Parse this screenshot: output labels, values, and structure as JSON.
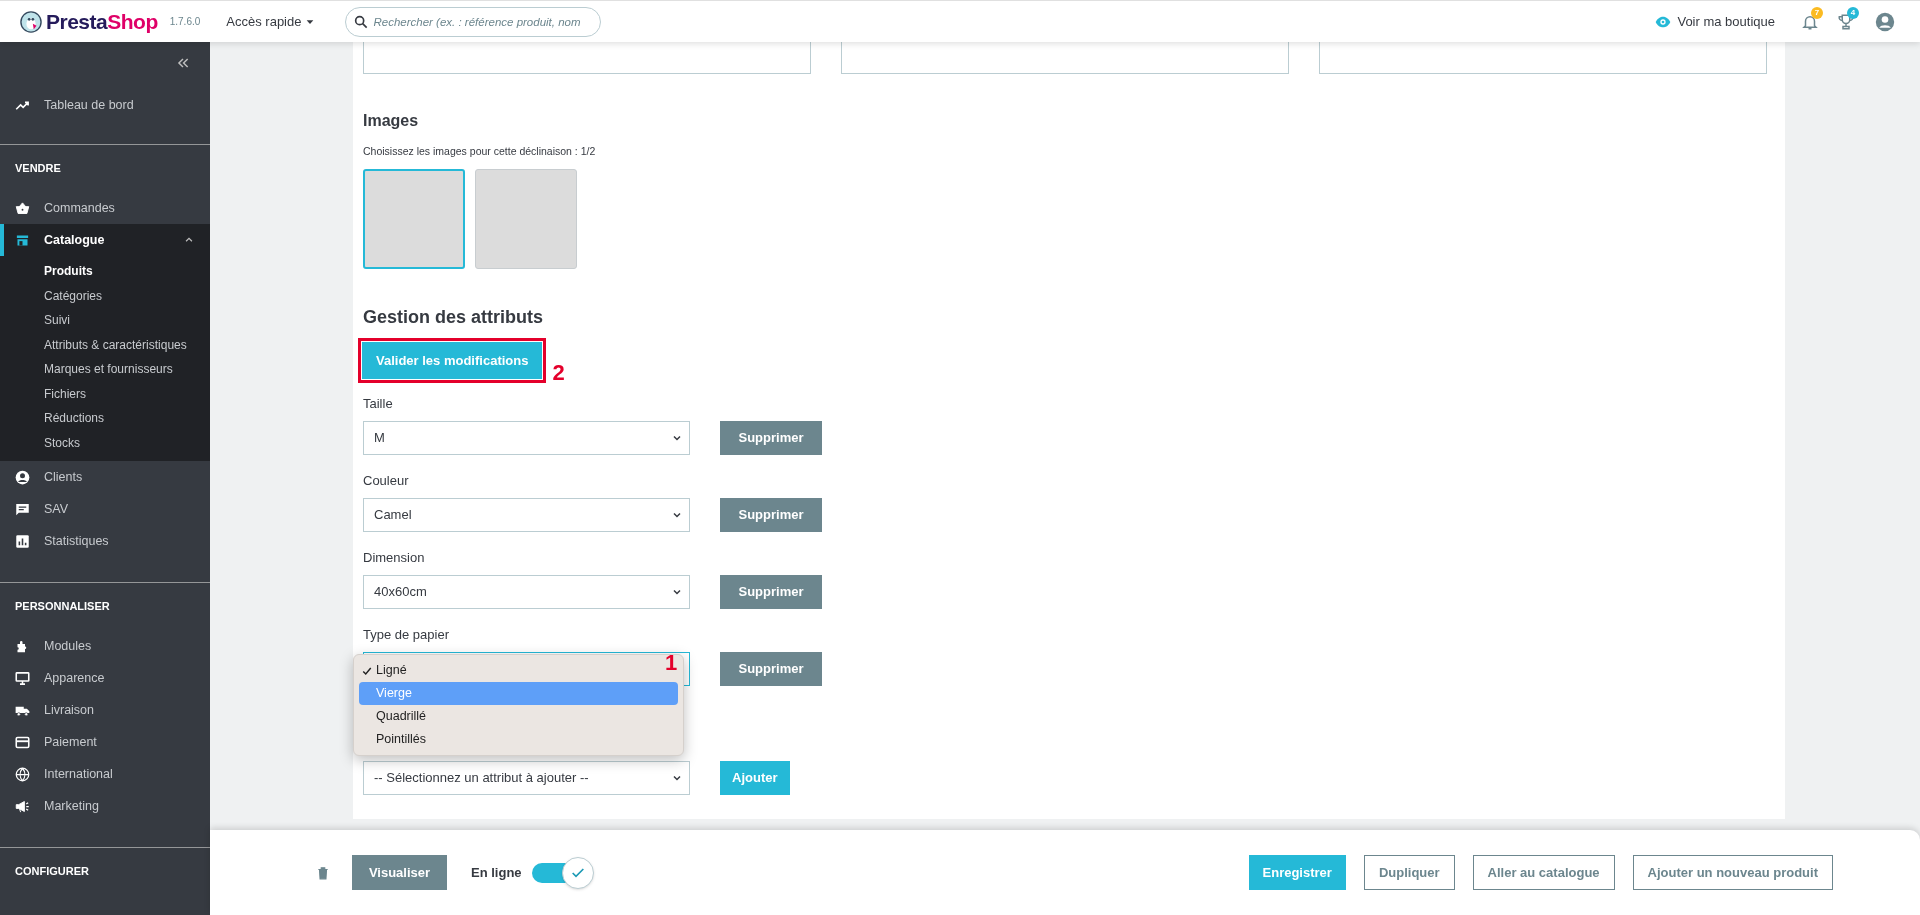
{
  "header": {
    "logo": [
      "Presta",
      "Shop"
    ],
    "version": "1.7.6.0",
    "quick_access": "Accès rapide",
    "search": {
      "placeholder": "Rechercher (ex. : référence produit, nom"
    },
    "view_shop": "Voir ma boutique",
    "notifications_badge": "7",
    "trophy_badge": "4"
  },
  "sidebar": {
    "sections": [
      {
        "items": [
          {
            "label": "Tableau de bord",
            "selected": false
          }
        ]
      },
      {
        "title": "VENDRE",
        "items": [
          {
            "label": "Commandes",
            "selected": false
          },
          {
            "label": "Catalogue",
            "selected": true,
            "children": [
              {
                "label": "Produits",
                "selected": true
              },
              {
                "label": "Catégories",
                "selected": false
              },
              {
                "label": "Suivi",
                "selected": false
              },
              {
                "label": "Attributs & caractéristiques",
                "selected": false
              },
              {
                "label": "Marques et fournisseurs",
                "selected": false
              },
              {
                "label": "Fichiers",
                "selected": false
              },
              {
                "label": "Réductions",
                "selected": false
              },
              {
                "label": "Stocks",
                "selected": false
              }
            ]
          },
          {
            "label": "Clients",
            "selected": false
          },
          {
            "label": "SAV",
            "selected": false
          },
          {
            "label": "Statistiques",
            "selected": false
          }
        ]
      },
      {
        "title": "PERSONNALISER",
        "items": [
          {
            "label": "Modules",
            "selected": false
          },
          {
            "label": "Apparence",
            "selected": false
          },
          {
            "label": "Livraison",
            "selected": false
          },
          {
            "label": "Paiement",
            "selected": false
          },
          {
            "label": "International",
            "selected": false
          },
          {
            "label": "Marketing",
            "selected": false
          }
        ]
      },
      {
        "title": "CONFIGURER"
      }
    ]
  },
  "images": {
    "title": "Images",
    "hint": "Choisissez les images pour cette déclinaison : 1/2",
    "thumbnails": [
      {
        "selected": true
      },
      {
        "selected": false
      }
    ]
  },
  "attributes": {
    "title": "Gestion des attributs",
    "save_button": {
      "label": "Valider les modifications",
      "annotation": "2"
    },
    "rows": [
      {
        "label": "Taille",
        "value": "M",
        "delete_button": "Supprimer"
      },
      {
        "label": "Couleur",
        "value": "Camel",
        "delete_button": "Supprimer"
      },
      {
        "label": "Dimension",
        "value": "40x60cm",
        "delete_button": "Supprimer"
      },
      {
        "label": "Type de papier",
        "delete_button": "Supprimer",
        "annotation": "1",
        "options": [
          {
            "label": "Ligné",
            "checked": true,
            "highlighted": false
          },
          {
            "label": "Vierge",
            "checked": false,
            "highlighted": true
          },
          {
            "label": "Quadrillé",
            "checked": false,
            "highlighted": false
          },
          {
            "label": "Pointillés",
            "checked": false,
            "highlighted": false
          }
        ]
      }
    ],
    "add": {
      "value": "-- Sélectionnez un attribut à ajouter --",
      "button": "Ajouter"
    }
  },
  "footer": {
    "preview_button": "Visualiser",
    "online_label": "En ligne",
    "online": true,
    "buttons": [
      {
        "label": "Enregistrer",
        "primary": true
      },
      {
        "label": "Dupliquer",
        "primary": false
      },
      {
        "label": "Aller au catalogue",
        "primary": false
      },
      {
        "label": "Ajouter un nouveau produit",
        "primary": false
      }
    ]
  }
}
